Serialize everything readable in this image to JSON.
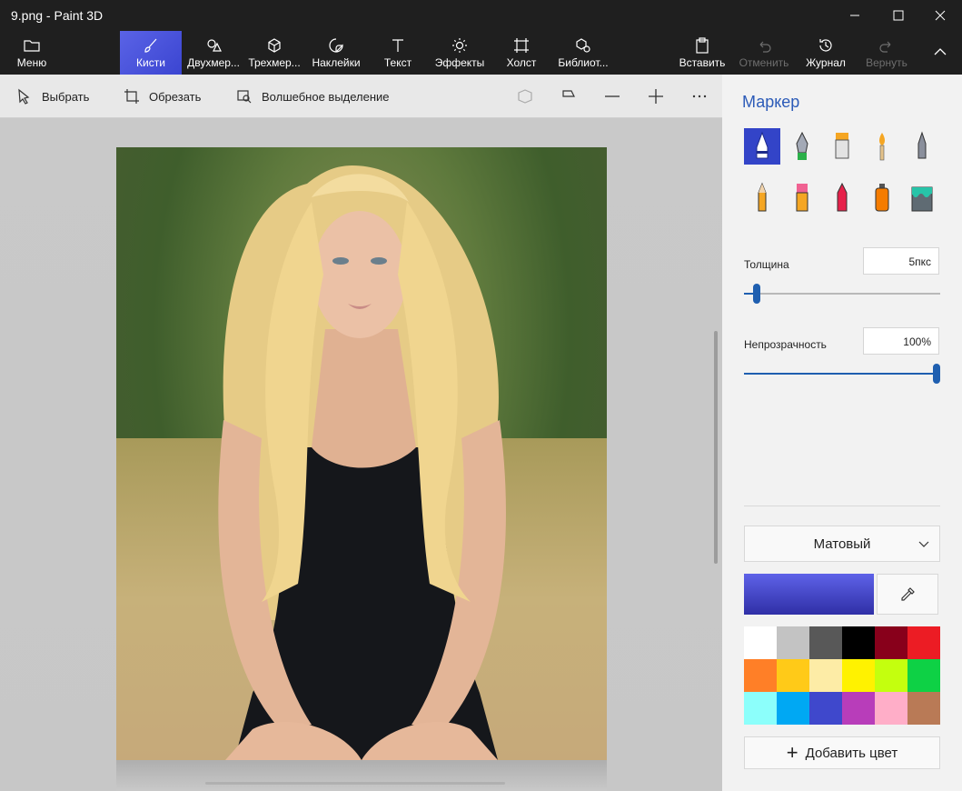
{
  "titlebar": {
    "title": "9.png - Paint 3D"
  },
  "ribbon": {
    "menu": "Меню",
    "brushes": "Кисти",
    "shapes2d": "Двухмер...",
    "shapes3d": "Трехмер...",
    "stickers": "Наклейки",
    "text": "Текст",
    "effects": "Эффекты",
    "canvas": "Холст",
    "library": "Библиот...",
    "paste": "Вставить",
    "undo": "Отменить",
    "history": "Журнал",
    "redo": "Вернуть"
  },
  "toolbar": {
    "select": "Выбрать",
    "crop": "Обрезать",
    "magic_select": "Волшебное выделение"
  },
  "panel": {
    "title": "Маркер",
    "brush_icons": [
      "marker-icon",
      "calligraphy-pen-icon",
      "oil-brush-icon",
      "watercolor-icon",
      "pixel-pen-icon",
      "pencil-icon",
      "eraser-icon",
      "crayon-icon",
      "spray-can-icon",
      "fill-bucket-icon"
    ],
    "thickness_label": "Толщина",
    "thickness_value": "5пкс",
    "thickness_level": 0.05,
    "opacity_label": "Непрозрачность",
    "opacity_value": "100%",
    "opacity_level": 1.0,
    "finish": "Матовый",
    "current_color": "#4a4fd4",
    "palette": [
      "#ffffff",
      "#c3c3c3",
      "#585858",
      "#000000",
      "#88001b",
      "#ec1c24",
      "#ff7f27",
      "#ffca18",
      "#fdeca6",
      "#fff200",
      "#c4ff0e",
      "#0ed145",
      "#8cfffb",
      "#00a8f3",
      "#3f48cc",
      "#b83dba",
      "#ffaec8",
      "#b97a56"
    ],
    "add_color": "Добавить цвет"
  }
}
